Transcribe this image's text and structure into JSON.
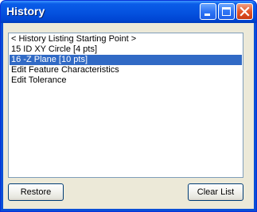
{
  "window": {
    "title": "History"
  },
  "titlebar_buttons": {
    "minimize_icon": "minimize-icon",
    "maximize_icon": "maximize-icon",
    "close_icon": "close-icon"
  },
  "history_list": {
    "items": [
      {
        "label": "< History Listing Starting Point >",
        "selected": false
      },
      {
        "label": "15 ID XY Circle [4 pts]",
        "selected": false
      },
      {
        "label": "16 -Z Plane [10 pts]",
        "selected": true
      },
      {
        "label": "Edit Feature Characteristics",
        "selected": false
      },
      {
        "label": "Edit Tolerance",
        "selected": false
      }
    ]
  },
  "buttons": {
    "restore_label": "Restore",
    "clear_label": "Clear List"
  },
  "colors": {
    "titlebar": "#0553e0",
    "selection": "#316ac5",
    "dialog_bg": "#ece9d8",
    "close_button": "#e3562a"
  }
}
